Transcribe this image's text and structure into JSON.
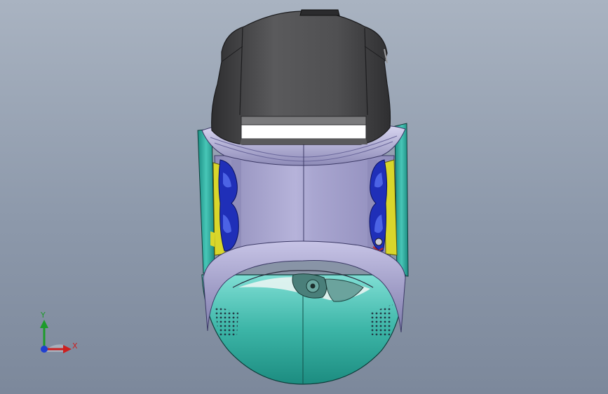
{
  "viewport": {
    "background_top": "#a9b3c1",
    "background_bottom": "#7c889b"
  },
  "triad": {
    "x_label": "X",
    "y_label": "Y",
    "x_color": "#cc1f1f",
    "y_color": "#1d9b2a",
    "z_color": "#1f3fd1"
  },
  "model_colors": {
    "top_shell": "#4d4d4f",
    "cavity": "#aaa7cf",
    "teal_body": "#3fb7a8",
    "accent_yellow": "#d9d62b",
    "accent_blue": "#1f2fb8"
  }
}
